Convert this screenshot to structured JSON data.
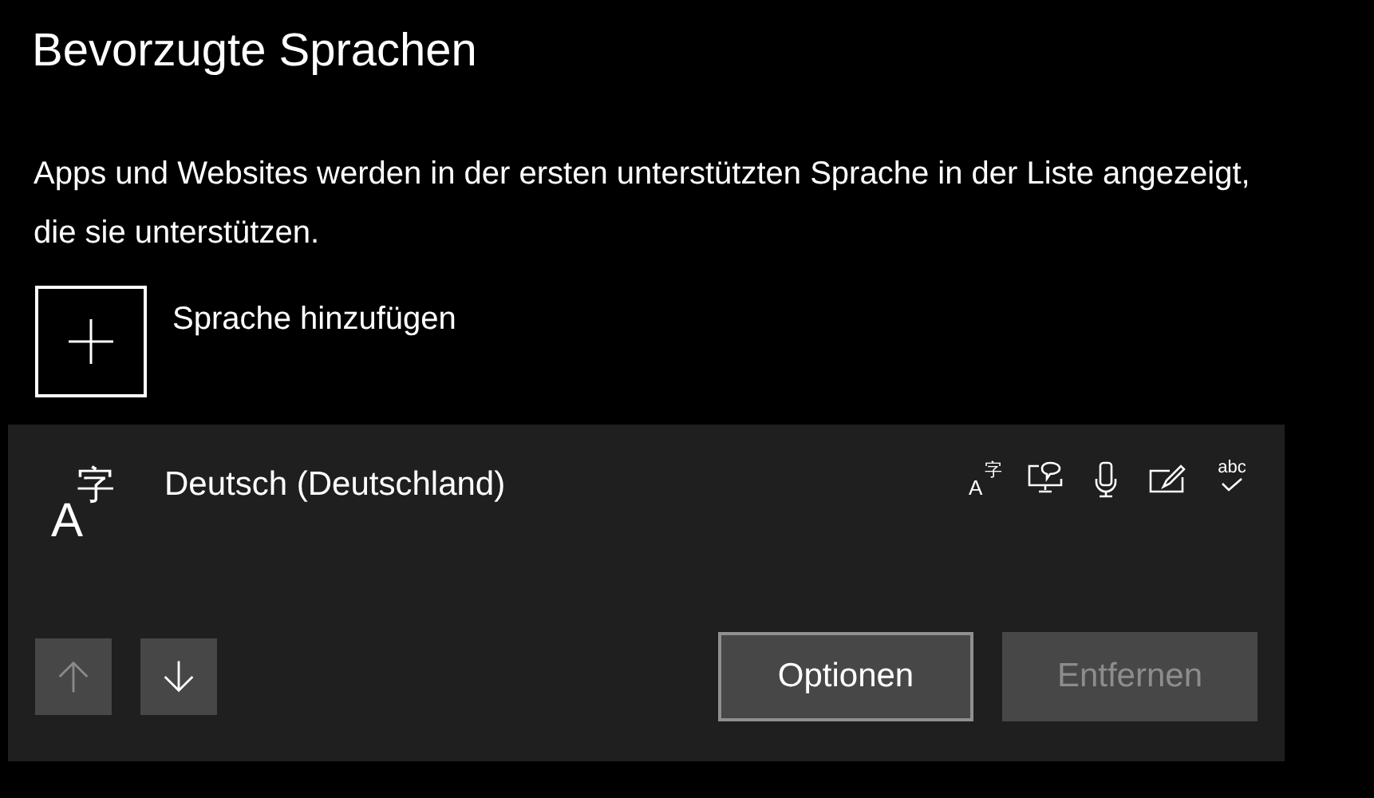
{
  "title": "Bevorzugte Sprachen",
  "description": "Apps und Websites werden in der ersten unterstützten Sprache in der Liste angezeigt, die sie unterstützen.",
  "add_language": {
    "label": "Sprache hinzufügen"
  },
  "languages": [
    {
      "name": "Deutsch (Deutschland)",
      "icon_latin": "A",
      "icon_cjk": "字",
      "features": [
        {
          "kind": "display",
          "latin": "A",
          "cjk": "字"
        },
        {
          "kind": "speech"
        },
        {
          "kind": "microphone"
        },
        {
          "kind": "handwriting"
        },
        {
          "kind": "spelling",
          "text": "abc"
        }
      ],
      "move_buttons": [
        {
          "kind": "up",
          "disabled": true
        },
        {
          "kind": "down",
          "disabled": false
        }
      ],
      "actions": [
        {
          "label": "Optionen",
          "disabled": false,
          "focused": true
        },
        {
          "label": "Entfernen",
          "disabled": true,
          "focused": false
        }
      ]
    }
  ]
}
